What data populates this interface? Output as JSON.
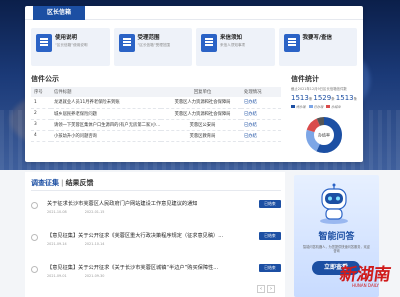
{
  "header": {
    "tab": "区长信箱"
  },
  "cards": [
    {
      "title": "使用说明",
      "desc": "“区长信箱”使用说明"
    },
    {
      "title": "受理范围",
      "desc": "“区长信箱”受理范围"
    },
    {
      "title": "来信须知",
      "desc": "来信人须知事项"
    },
    {
      "title": "我要写/查信",
      "desc": ""
    }
  ],
  "public": {
    "title": "信件公示",
    "columns": [
      "序号",
      "信件标题",
      "回复单位",
      "处理情况"
    ],
    "rows": [
      [
        "1",
        "龙退就业人员11月养老保险未到账",
        "芙蓉区人力资源和社会保障局",
        "已办结"
      ],
      [
        "2",
        "城乡居民养老保险问题",
        "芙蓉区人力资源和社会保障局",
        "已办结"
      ],
      [
        "3",
        "请领一下芙蓉区集体户口生源四的(有户无房第二家)小...",
        "芙蓉区公安局",
        "已办结"
      ],
      [
        "4",
        "小孩幼升小的问题咨询",
        "芙蓉区教育局",
        "已办结"
      ]
    ]
  },
  "stats": {
    "title": "信件统计",
    "sub": "截止2021年12月9日区长信箱信件数",
    "counts": [
      {
        "value": "1513",
        "unit": "条"
      },
      {
        "value": "1529",
        "unit": "条"
      },
      {
        "value": "1513",
        "unit": "条"
      }
    ],
    "legend": [
      "待办理",
      "已办理",
      "办结中"
    ],
    "pie_label": "办结率",
    "colors": {
      "a": "#1c4fa3",
      "b": "#7da6e6",
      "c": "#d94b4b",
      "d": "#bbbbbb"
    }
  },
  "bottom": {
    "tab_on": "调查征集",
    "tab_off": "结果反馈",
    "items": [
      {
        "title": "关于征求长沙市芙蓉区人民政府门户网站建设工作意见建议的通知",
        "d1": "2021-10-08",
        "d2": "2022-01-15",
        "btn": "已结束"
      },
      {
        "title": "【意见征集】关于公开征求《芙蓉区重大行政决策程序规定（征求意见稿）...",
        "d1": "2021-09-14",
        "d2": "2021-10-14",
        "btn": "已结束"
      },
      {
        "title": "【意见征集】关于公开征求《关于长沙市芙蓉区城镇“半边户”购买保障性...",
        "d1": "2021-09-01",
        "d2": "2021-09-30",
        "btn": "已结束"
      }
    ],
    "pager": [
      "‹",
      "›"
    ]
  },
  "promo": {
    "title": "智能问答",
    "desc": "智能问答机器人，为您提供快速问答服务，欢迎咨询",
    "button": "立即查看"
  },
  "watermark": {
    "brand": "新湖南",
    "sub": "HUNAN DAILY"
  }
}
